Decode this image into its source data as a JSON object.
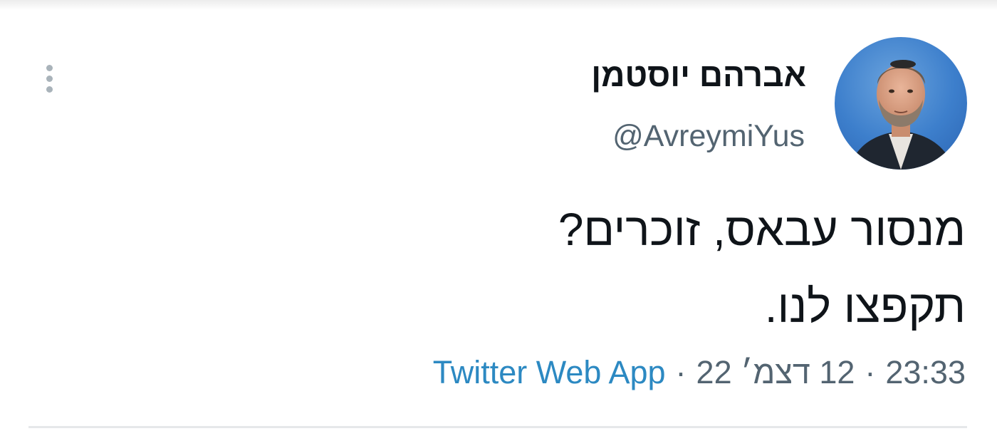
{
  "tweet": {
    "author": {
      "display_name": "אברהם יוסטמן",
      "handle": "@AvreymiYus",
      "avatar": "profile-photo-man-dark-jacket-blue-background"
    },
    "text_lines": [
      "מנסור עבאס, זוכרים?",
      "תקפצו לנו."
    ],
    "time": "23:33",
    "date": "12 דצמ׳ 22",
    "separator": "·",
    "source": "Twitter Web App",
    "more_icon": "vertical-ellipsis-icon"
  },
  "colors": {
    "text_primary": "#0f1419",
    "text_secondary": "#536471",
    "link": "#2c89c2",
    "divider": "#e6e8ea",
    "more_icon": "#a9b3ba"
  }
}
